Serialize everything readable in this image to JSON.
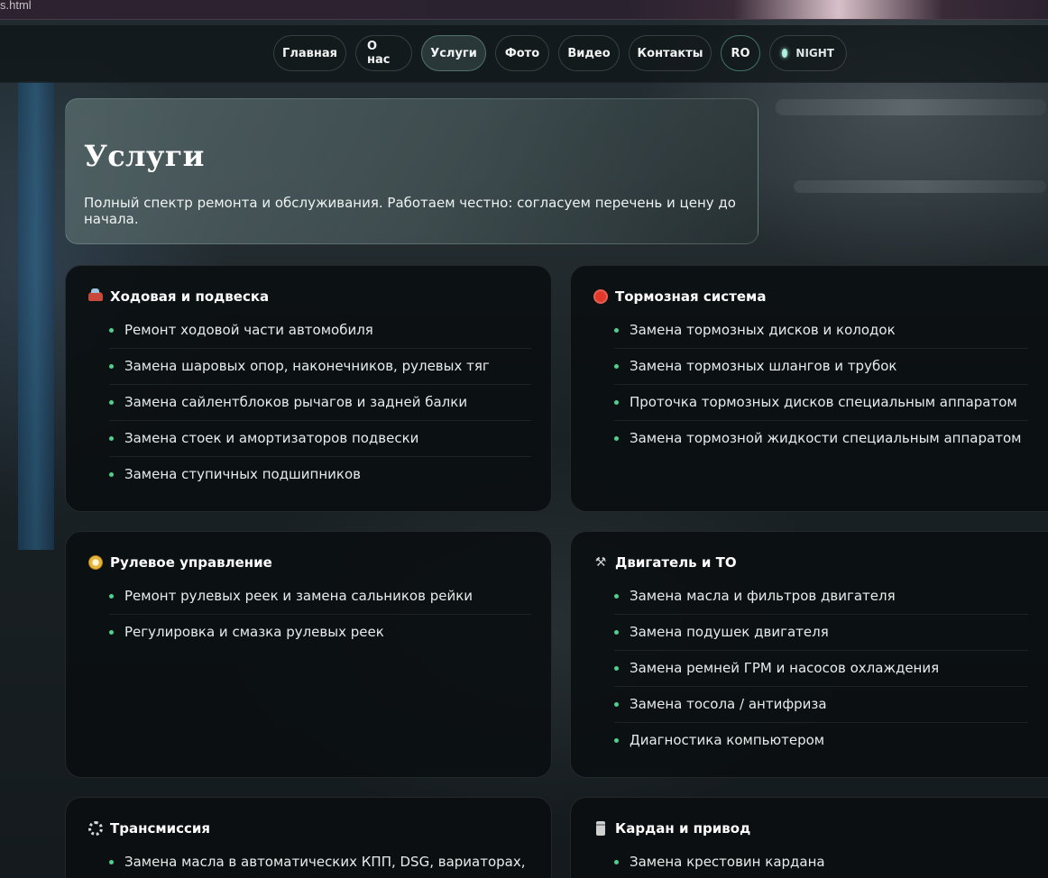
{
  "browser": {
    "url_fragment": "s.html"
  },
  "nav": {
    "items": [
      {
        "label": "Главная"
      },
      {
        "label": "О нас"
      },
      {
        "label": "Услуги",
        "active": true
      },
      {
        "label": "Фото"
      },
      {
        "label": "Видео"
      },
      {
        "label": "Контакты"
      }
    ],
    "lang_label": "RO",
    "theme_label": "NIGHT"
  },
  "hero": {
    "title": "Услуги",
    "subtitle": "Полный спектр ремонта и обслуживания. Работаем честно: согласуем перечень и цену до начала."
  },
  "cards": [
    {
      "icon": "car-icon",
      "title": "Ходовая и подвеска",
      "items": [
        "Ремонт ходовой части автомобиля",
        "Замена шаровых опор, наконечников, рулевых тяг",
        "Замена сайлентблоков рычагов и задней балки",
        "Замена стоек и амортизаторов подвески",
        "Замена ступичных подшипников"
      ]
    },
    {
      "icon": "stop-sign-icon",
      "title": "Тормозная система",
      "items": [
        "Замена тормозных дисков и колодок",
        "Замена тормозных шлангов и трубок",
        "Проточка тормозных дисков специальным аппаратом",
        "Замена тормозной жидкости специальным аппаратом"
      ]
    },
    {
      "icon": "compass-icon",
      "title": "Рулевое управление",
      "items": [
        "Ремонт рулевых реек и замена сальников рейки",
        "Регулировка и смазка рулевых реек"
      ]
    },
    {
      "icon": "tools-icon",
      "title": "Двигатель и ТО",
      "items": [
        "Замена масла и фильтров двигателя",
        "Замена подушек двигателя",
        "Замена ремней ГРМ и насосов охлаждения",
        "Замена тосола / антифриза",
        "Диагностика компьютером"
      ]
    },
    {
      "icon": "gear-icon",
      "title": "Трансмиссия",
      "items": [
        "Замена масла в автоматических КПП, DSG, вариаторах,"
      ]
    },
    {
      "icon": "bolt-icon",
      "title": "Кардан и привод",
      "items": [
        "Замена крестовин кардана"
      ]
    }
  ]
}
